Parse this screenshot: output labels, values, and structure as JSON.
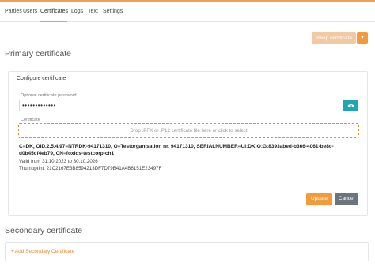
{
  "nav": {
    "tabs": [
      {
        "label": "Parties"
      },
      {
        "label": "Users"
      },
      {
        "label": "Certificates"
      },
      {
        "label": "Logs"
      },
      {
        "label": "Text"
      },
      {
        "label": "Settings"
      }
    ],
    "active_tab": "Certificates"
  },
  "toolbar": {
    "swap_label": "Swap certificate",
    "swap_caret": "▾"
  },
  "primary": {
    "title": "Primary certificate",
    "card_title": "Configure certificate",
    "password_label": "Optional certificate password",
    "password_value": "•••••••••••••",
    "certificate_label": "Certificate",
    "drop_text": "Drop .PFX or .P12 certificate file here or click to select",
    "subject": "C=DK, OID.2.5.4.97=NTRDK-94171310, O=Testorganisation nr. 94171310, SERIALNUMBER=UI:DK-O:G:8393abed-b366-4061-be8c-d0b45cf4eb79, CN=foxids-testcorp-ch1",
    "valid": "Valid from 31.10.2023 to 30.10.2026",
    "thumbprint": "Thumbprint: 21C2167E3B8594213DF7D79B41A4B6151E23497F",
    "update_label": "Update",
    "cancel_label": "Cancel"
  },
  "secondary": {
    "title": "Secondary certificate",
    "add_label": "Add Secondary Certificate"
  },
  "colors": {
    "accent": "#f39a3d",
    "teal": "#1fa4b8",
    "cancel": "#6c757d"
  }
}
